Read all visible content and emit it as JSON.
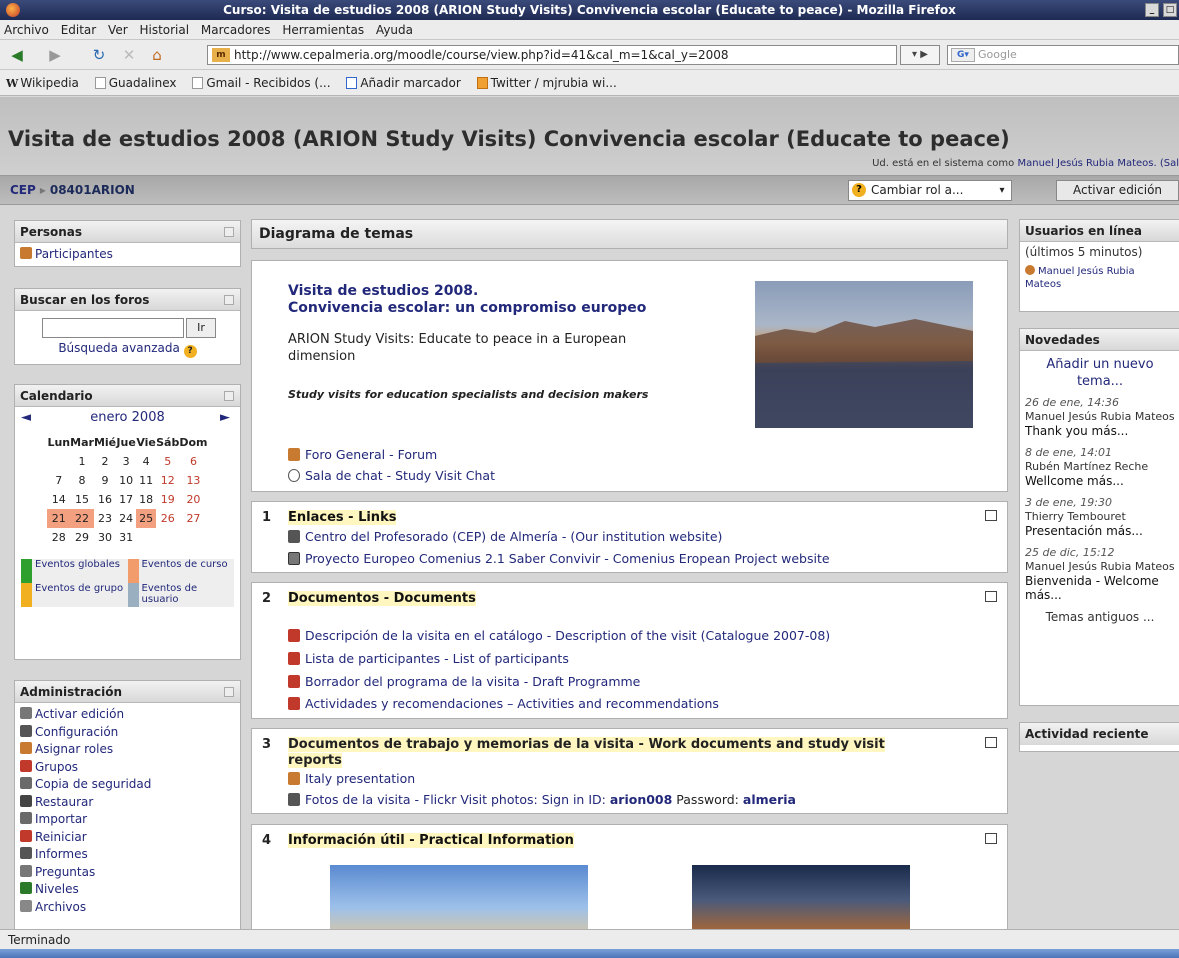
{
  "window": {
    "title": "Curso: Visita de estudios 2008 (ARION Study Visits) Convivencia escolar (Educate to peace) - Mozilla Firefox"
  },
  "menu": [
    "Archivo",
    "Editar",
    "Ver",
    "Historial",
    "Marcadores",
    "Herramientas",
    "Ayuda"
  ],
  "nav": {
    "url": "http://www.cepalmeria.org/moodle/course/view.php?id=41&cal_m=1&cal_y=2008",
    "search_placeholder": "Google"
  },
  "bookmarks": [
    "Wikipedia",
    "Guadalinex",
    "Gmail - Recibidos (...",
    "Añadir marcador",
    "Twitter / mjrubia wi..."
  ],
  "page": {
    "title": "Visita de estudios 2008 (ARION Study Visits) Convivencia escolar (Educate to peace)",
    "login_prefix": "Ud. está en el sistema como",
    "login_user": "Manuel Jesús Rubia Mateos.",
    "login_suffix": "(Sal"
  },
  "breadcrumb": {
    "home": "CEP",
    "course": "08401ARION"
  },
  "role_select": "Cambiar rol a...",
  "edit_button": "Activar edición",
  "personas": {
    "title": "Personas",
    "participants": "Participantes"
  },
  "search_forums": {
    "title": "Buscar en los foros",
    "go": "Ir",
    "advanced": "Búsqueda avanzada"
  },
  "calendar": {
    "title": "Calendario",
    "month": "enero 2008",
    "days": [
      "Lun",
      "Mar",
      "Mié",
      "Jue",
      "Vie",
      "Sáb",
      "Dom"
    ],
    "weeks": [
      [
        "",
        "1",
        "2",
        "3",
        "4",
        "5",
        "6"
      ],
      [
        "7",
        "8",
        "9",
        "10",
        "11",
        "12",
        "13"
      ],
      [
        "14",
        "15",
        "16",
        "17",
        "18",
        "19",
        "20"
      ],
      [
        "21",
        "22",
        "23",
        "24",
        "25",
        "26",
        "27"
      ],
      [
        "28",
        "29",
        "30",
        "31",
        "",
        "",
        ""
      ]
    ],
    "highlighted": [
      "21",
      "22",
      "25"
    ],
    "legend": [
      {
        "label": "Eventos globales",
        "color": "#2ea02e"
      },
      {
        "label": "Eventos de curso",
        "color": "#f39c6b"
      },
      {
        "label": "Eventos de grupo",
        "color": "#f0b020"
      },
      {
        "label": "Eventos de usuario",
        "color": "#9ab0c0"
      }
    ]
  },
  "admin": {
    "title": "Administración",
    "items": [
      "Activar edición",
      "Configuración",
      "Asignar roles",
      "Grupos",
      "Copia de seguridad",
      "Restaurar",
      "Importar",
      "Reiniciar",
      "Informes",
      "Preguntas",
      "Niveles",
      "Archivos"
    ]
  },
  "topics": {
    "title": "Diagrama de temas",
    "intro_title1": "Visita de estudios 2008.",
    "intro_title2": "Convivencia escolar: un compromiso europeo",
    "intro_text1": "ARION Study Visits: Educate to peace in a European",
    "intro_text2": "dimension",
    "intro_italic": "Study visits for education specialists and decision makers",
    "forum": "Foro General - Forum",
    "chat": "Sala de chat - Study Visit Chat"
  },
  "sections": [
    {
      "num": "1",
      "title": "Enlaces - Links",
      "items": [
        "Centro del Profesorado (CEP) de Almería - (Our institution website)",
        "Proyecto Europeo Comenius 2.1 Saber Convivir - Comenius Eropean Project website"
      ]
    },
    {
      "num": "2",
      "title": "Documentos - Documents",
      "items": [
        "Descripción de la visita en el catálogo - Description of the visit (Catalogue 2007-08)",
        "Lista de participantes - List of participants",
        "Borrador del programa de la visita - Draft Programme",
        "Actividades y recomendaciones – Activities and recommendations"
      ]
    },
    {
      "num": "3",
      "title": "Documentos de trabajo y memorias de la visita - Work documents and study visit",
      "title2": "reports",
      "items": [
        "Italy presentation"
      ],
      "photo_label": "Fotos de la visita - Flickr Visit photos: Sign in ID:",
      "photo_id": "arion008",
      "photo_pw_label": "Password:",
      "photo_pw": "almeria"
    },
    {
      "num": "4",
      "title": "Información útil - Practical Information"
    }
  ],
  "online": {
    "title": "Usuarios en línea",
    "subtitle": "(últimos 5 minutos)",
    "user1": "Manuel Jesús Rubia",
    "user2": "Mateos"
  },
  "news": {
    "title": "Novedades",
    "add": "Añadir un nuevo tema...",
    "posts": [
      {
        "date": "26 de ene, 14:36",
        "author": "Manuel Jesús Rubia Mateos",
        "text": "Thank you más..."
      },
      {
        "date": "8 de ene, 14:01",
        "author": "Rubén Martínez Reche",
        "text": "Wellcome más..."
      },
      {
        "date": "3 de ene, 19:30",
        "author": "Thierry Tembouret",
        "text": "Presentación más..."
      },
      {
        "date": "25 de dic, 15:12",
        "author": "Manuel Jesús Rubia Mateos",
        "text": "Bienvenida - Welcome más..."
      }
    ],
    "older": "Temas antiguos ..."
  },
  "recent": {
    "title": "Actividad reciente"
  },
  "status": "Terminado"
}
